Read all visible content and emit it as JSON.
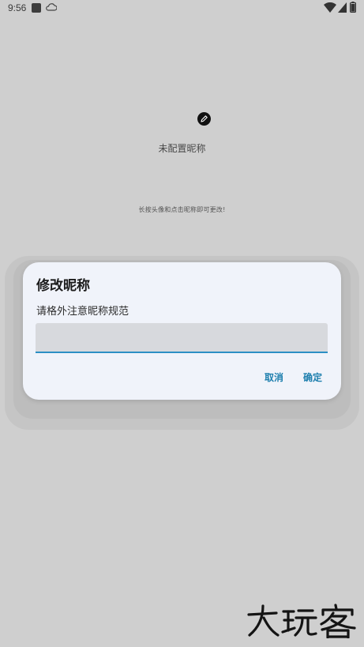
{
  "status_bar": {
    "time": "9:56",
    "icons": [
      "app-square-icon",
      "cloud-icon",
      "wifi-icon",
      "signal-icon",
      "battery-icon"
    ]
  },
  "background": {
    "edit_icon": "edit-pencil-icon",
    "nickname": "未配置昵称",
    "hint": "长按头像和点击昵称即可更改!"
  },
  "dialog": {
    "title": "修改昵称",
    "message": "请格外注意昵称规范",
    "input_value": "",
    "cancel_label": "取消",
    "confirm_label": "确定"
  },
  "watermark": {
    "text": "大玩客"
  },
  "colors": {
    "background": "#cfcfcf",
    "dialog_background": "#f0f3fa",
    "accent": "#1e7fae",
    "input_underline": "#2c8fc4"
  }
}
